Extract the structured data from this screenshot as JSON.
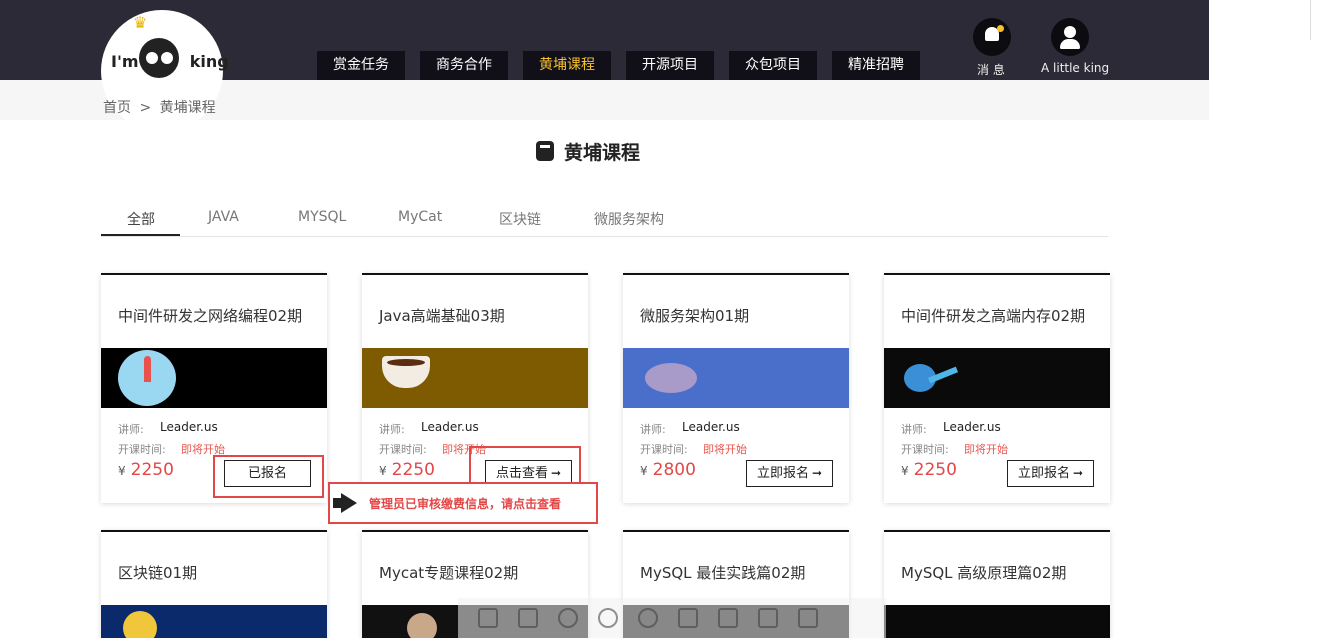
{
  "logo": {
    "text_left": "I'm",
    "text_right": "king",
    "crown": "♛"
  },
  "nav": {
    "items": [
      {
        "label": "赏金任务",
        "active": false
      },
      {
        "label": "商务合作",
        "active": false
      },
      {
        "label": "黄埔课程",
        "active": true
      },
      {
        "label": "开源项目",
        "active": false
      },
      {
        "label": "众包项目",
        "active": false
      },
      {
        "label": "精准招聘",
        "active": false
      }
    ]
  },
  "header_actions": {
    "messages_label": "消 息",
    "user_label": "A little king",
    "messages_icon": "bell-icon",
    "user_icon": "user-icon"
  },
  "breadcrumb": {
    "home": "首页",
    "separator": ">",
    "current": "黄埔课程"
  },
  "page_title": "黄埔课程",
  "tabs": [
    {
      "label": "全部",
      "active": true
    },
    {
      "label": "JAVA",
      "active": false
    },
    {
      "label": "MYSQL",
      "active": false
    },
    {
      "label": "MyCat",
      "active": false
    },
    {
      "label": "区块链",
      "active": false
    },
    {
      "label": "微服务架构",
      "active": false
    }
  ],
  "card_labels": {
    "instructor": "讲师:",
    "start_time": "开课时间:",
    "currency": "¥"
  },
  "courses": [
    {
      "title": "中间件研发之网络编程02期",
      "instructor": "Leader.us",
      "start": "即将开始",
      "price": "2250",
      "button": "已报名",
      "arrow": "",
      "image_bg": "#000000"
    },
    {
      "title": "Java高端基础03期",
      "instructor": "Leader.us",
      "start": "即将开始",
      "price": "2250",
      "button": "点击查看",
      "arrow": "➞",
      "image_bg": "#7e5a00"
    },
    {
      "title": "微服务架构01期",
      "instructor": "Leader.us",
      "start": "即将开始",
      "price": "2800",
      "button": "立即报名",
      "arrow": "➞",
      "image_bg": "#4a6fcb"
    },
    {
      "title": "中间件研发之高端内存02期",
      "instructor": "Leader.us",
      "start": "即将开始",
      "price": "2250",
      "button": "立即报名",
      "arrow": "➞",
      "image_bg": "#0a0a0a"
    },
    {
      "title": "区块链01期",
      "image_bg": "#0b2a6b"
    },
    {
      "title": "Mycat专题课程02期",
      "image_bg": "#111111"
    },
    {
      "title": "MySQL 最佳实践篇02期",
      "image_bg": "#0b0b0b"
    },
    {
      "title": "MySQL 高级原理篇02期",
      "image_bg": "#0a0a0a"
    }
  ],
  "notice": {
    "text": "管理员已审核缴费信息，请点击查看",
    "icon": "megaphone-icon"
  },
  "colors": {
    "header_bg": "#2b2a36",
    "nav_bg": "#111018",
    "nav_active": "#f5c12e",
    "price": "#e34848",
    "highlight": "#e34848"
  }
}
